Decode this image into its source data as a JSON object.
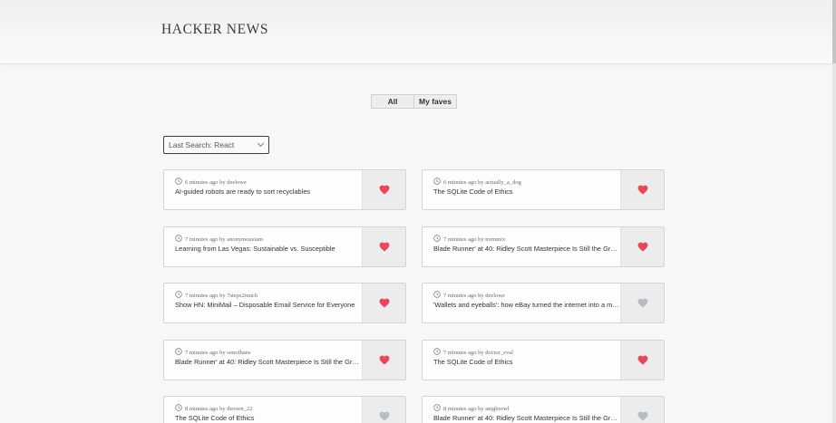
{
  "header": {
    "title": "HACKER NEWS"
  },
  "tabs": [
    {
      "label": "All",
      "active": true
    },
    {
      "label": "My faves",
      "active": false
    }
  ],
  "search_select": {
    "value": "Last Search: React"
  },
  "colors": {
    "heart_faved": "#e8475c",
    "heart_unfaved": "#b5bcc4"
  },
  "cards": [
    {
      "meta": "6 minutes ago by deelowe",
      "title": "AI-guided robots are ready to sort recyclables",
      "faved": true
    },
    {
      "meta": "6 minutes ago by actually_a_dog",
      "title": "The SQLite Code of Ethics",
      "faved": true
    },
    {
      "meta": "7 minutes ago by anonymousiam",
      "title": "Learning from Las Vegas: Sustainable vs. Susceptible",
      "faved": true
    },
    {
      "meta": "7 minutes ago by tremmix",
      "title": "Blade Runner' at 40: Ridley Scott Masterpiece Is Still the Greate...",
      "faved": true
    },
    {
      "meta": "7 minutes ago by 7steps2much",
      "title": "Show HN: MiniMail – Disposable Email Service for Everyone",
      "faved": true
    },
    {
      "meta": "7 minutes ago by deelowe",
      "title": "'Wallets and eyeballs': how eBay turned the internet into a mark...",
      "faved": false
    },
    {
      "meta": "7 minutes ago by sonofhans",
      "title": "Blade Runner' at 40: Ridley Scott Masterpiece Is Still the Greate...",
      "faved": true
    },
    {
      "meta": "7 minutes ago by doctor_eval",
      "title": "The SQLite Code of Ethics",
      "faved": true
    },
    {
      "meta": "8 minutes ago by thrown_22",
      "title": "The SQLite Code of Ethics",
      "faved": false
    },
    {
      "meta": "8 minutes ago by anigbrowl",
      "title": "Blade Runner' at 40: Ridley Scott Masterpiece Is Still the Greate...",
      "faved": false
    }
  ]
}
